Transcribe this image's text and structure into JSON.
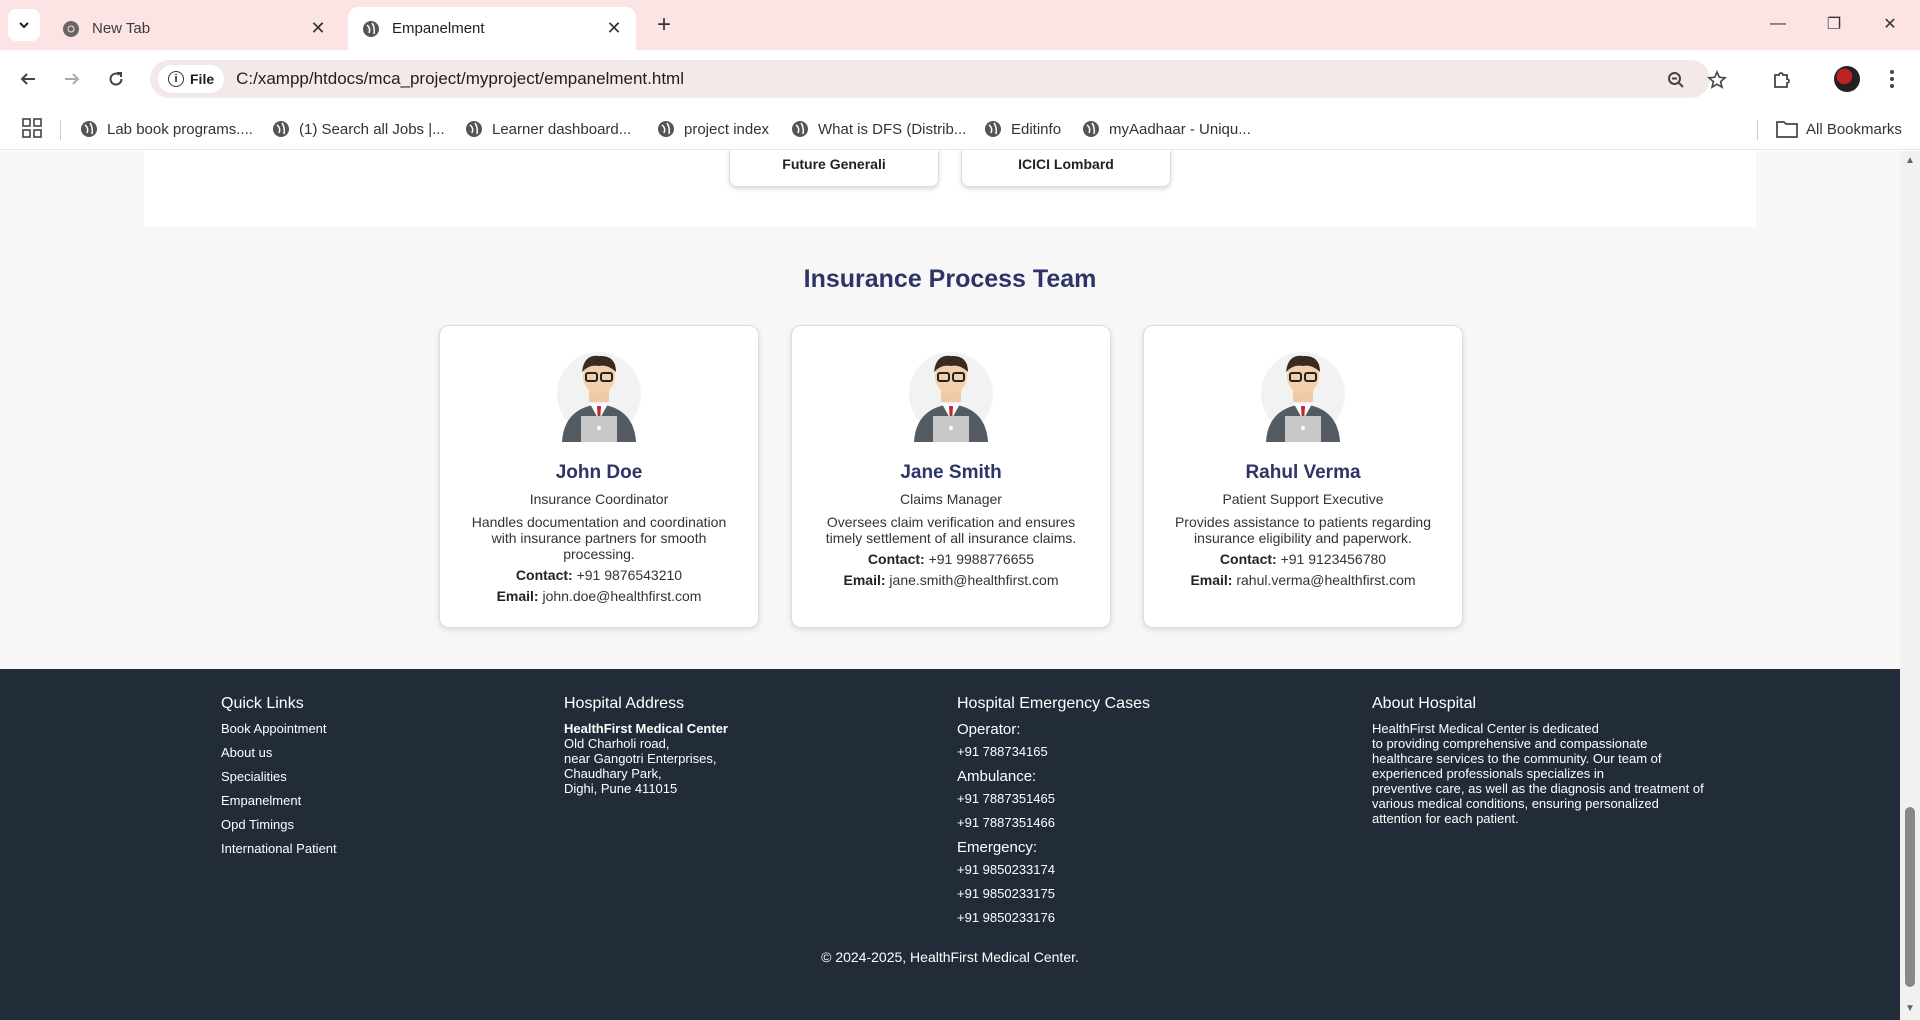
{
  "browser": {
    "tabs": [
      {
        "title": "New Tab",
        "active": false
      },
      {
        "title": "Empanelment",
        "active": true
      }
    ],
    "site_chip": "File",
    "url": "C:/xampp/htdocs/mca_project/myproject/empanelment.html",
    "bookmarks": [
      "Lab book programs....",
      "(1) Search all Jobs |...",
      "Learner dashboard...",
      "project index",
      "What is DFS (Distrib...",
      "Editinfo",
      "myAadhaar - Uniqu..."
    ],
    "all_bookmarks": "All Bookmarks"
  },
  "insurers": [
    "Future Generali",
    "ICICI Lombard"
  ],
  "team": {
    "title": "Insurance Process Team",
    "contact_label": "Contact:",
    "email_label": "Email:",
    "members": [
      {
        "name": "John Doe",
        "role": "Insurance Coordinator",
        "desc": "Handles documentation and coordination with insurance partners for smooth processing.",
        "contact": "+91 9876543210",
        "email": "john.doe@healthfirst.com"
      },
      {
        "name": "Jane Smith",
        "role": "Claims Manager",
        "desc": "Oversees claim verification and ensures timely settlement of all insurance claims.",
        "contact": "+91 9988776655",
        "email": "jane.smith@healthfirst.com"
      },
      {
        "name": "Rahul Verma",
        "role": "Patient Support Executive",
        "desc": "Provides assistance to patients regarding insurance eligibility and paperwork.",
        "contact": "+91 9123456780",
        "email": "rahul.verma@healthfirst.com"
      }
    ]
  },
  "footer": {
    "quick_links": {
      "title": "Quick Links",
      "items": [
        "Book Appointment",
        "About us",
        "Specialities",
        "Empanelment",
        "Opd Timings",
        "International Patient"
      ]
    },
    "address": {
      "title": "Hospital Address",
      "name": "HealthFirst Medical Center",
      "lines": [
        "Old Charholi road,",
        "near Gangotri Enterprises,",
        "Chaudhary Park,",
        "Dighi, Pune 411015"
      ]
    },
    "emergency": {
      "title": "Hospital Emergency Cases",
      "operator_label": "Operator:",
      "operator": [
        "+91 788734165"
      ],
      "ambulance_label": "Ambulance:",
      "ambulance": [
        "+91 7887351465",
        "+91 7887351466"
      ],
      "emergency_label": "Emergency:",
      "emergency": [
        "+91 9850233174",
        "+91 9850233175",
        "+91 9850233176"
      ]
    },
    "about": {
      "title": "About Hospital",
      "lines": [
        "HealthFirst Medical Center is dedicated",
        "to providing comprehensive and compassionate",
        "healthcare services to the community. Our team of",
        "experienced professionals specializes in",
        "preventive care, as well as the diagnosis and treatment of",
        "various medical conditions, ensuring personalized",
        "attention for each patient."
      ]
    },
    "copyright": "© 2024-2025, HealthFirst Medical Center."
  }
}
